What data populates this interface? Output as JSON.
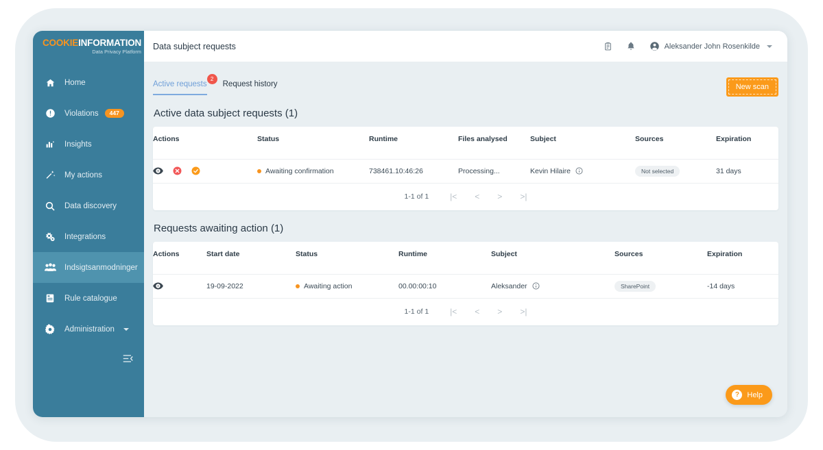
{
  "brand": {
    "name_part1": "COOKIE",
    "name_part2": "INFORMATION",
    "tagline": "Data Privacy Platform",
    "accent": "#f79420",
    "sidebar_bg": "#3a7d9b"
  },
  "sidebar": {
    "items": [
      {
        "label": "Home",
        "icon": "home-icon",
        "badge": null,
        "active": false,
        "caret": false
      },
      {
        "label": "Violations",
        "icon": "alert-circle-icon",
        "badge": "447",
        "active": false,
        "caret": false
      },
      {
        "label": "Insights",
        "icon": "bar-chart-icon",
        "badge": null,
        "active": false,
        "caret": false
      },
      {
        "label": "My actions",
        "icon": "magic-wand-icon",
        "badge": null,
        "active": false,
        "caret": false
      },
      {
        "label": "Data discovery",
        "icon": "search-icon",
        "badge": null,
        "active": false,
        "caret": false
      },
      {
        "label": "Integrations",
        "icon": "gears-icon",
        "badge": null,
        "active": false,
        "caret": false
      },
      {
        "label": "Indsigtsanmodninger",
        "icon": "people-group-icon",
        "badge": null,
        "active": true,
        "caret": false
      },
      {
        "label": "Rule catalogue",
        "icon": "book-icon",
        "badge": null,
        "active": false,
        "caret": false
      },
      {
        "label": "Administration",
        "icon": "gear-icon",
        "badge": null,
        "active": false,
        "caret": true
      }
    ],
    "collapse_icon": "collapse-menu-icon"
  },
  "header": {
    "title": "Data subject requests",
    "clipboard_icon": "clipboard-icon",
    "bell_icon": "bell-icon",
    "avatar_icon": "user-avatar-icon",
    "user_name": "Aleksander John Rosenkilde",
    "chevron_icon": "chevron-down-icon"
  },
  "tabs": [
    {
      "label": "Active requests",
      "active": true,
      "badge": "2"
    },
    {
      "label": "Request history",
      "active": false,
      "badge": null
    }
  ],
  "new_scan_button": {
    "label": "New scan",
    "color": "#fb9a1a"
  },
  "active_requests": {
    "title": "Active data subject requests",
    "count": "(1)",
    "columns": [
      "Actions",
      "Status",
      "Runtime",
      "Files analysed",
      "Subject",
      "Sources",
      "Expiration"
    ],
    "rows": [
      {
        "actions": [
          "eye-icon",
          "reject-circle-icon",
          "approve-circle-icon"
        ],
        "status": "Awaiting confirmation",
        "status_color": "#f79420",
        "runtime": "738461.10:46:26",
        "files_analysed": "Processing...",
        "subject": "Kevin Hilaire",
        "subject_info_icon": "info-icon",
        "sources": "Not selected",
        "expiration": "31 days"
      }
    ],
    "pager": {
      "range": "1-1 of 1",
      "first": "|<",
      "prev": "<",
      "next": ">",
      "last": ">|"
    }
  },
  "awaiting_action": {
    "title": "Requests awaiting action",
    "count": "(1)",
    "columns": [
      "Actions",
      "Start date",
      "Status",
      "Runtime",
      "Subject",
      "Sources",
      "Expiration"
    ],
    "rows": [
      {
        "actions": [
          "eye-icon"
        ],
        "start_date": "19-09-2022",
        "status": "Awaiting action",
        "status_color": "#f79420",
        "runtime": "00.00:00:10",
        "subject": "Aleksander",
        "subject_info_icon": "info-icon",
        "sources": "SharePoint",
        "expiration": "-14 days"
      }
    ],
    "pager": {
      "range": "1-1 of 1",
      "first": "|<",
      "prev": "<",
      "next": ">",
      "last": ">|"
    }
  },
  "help_button": {
    "label": "Help",
    "icon": "question-mark-icon"
  }
}
